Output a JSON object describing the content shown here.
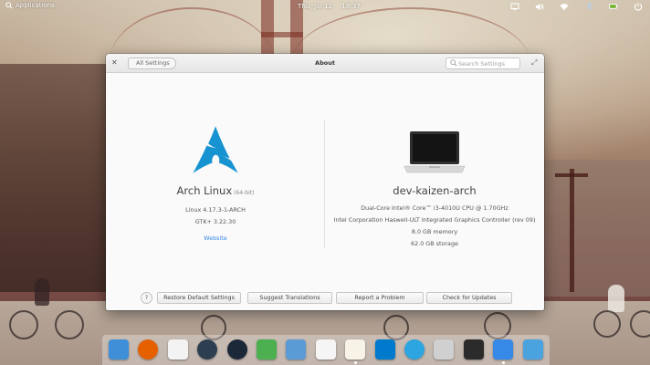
{
  "panel": {
    "applications_label": "Applications",
    "date": "Thu, Jul 12",
    "time": "18:37",
    "indicators": [
      "display-icon",
      "volume-icon",
      "wifi-icon",
      "bluetooth-icon",
      "battery-icon",
      "power-icon"
    ]
  },
  "window": {
    "title": "About",
    "back_label": "All Settings",
    "search_placeholder": "Search Settings",
    "close_icon": "close-icon",
    "maximize_icon": "maximize-icon"
  },
  "os": {
    "name": "Arch Linux",
    "arch": "(64-bit)",
    "kernel": "Linux 4.17.3-1-ARCH",
    "gtk": "GTK+ 3.22.30",
    "website_label": "Website",
    "logo_color": "#1793d1"
  },
  "hardware": {
    "hostname": "dev-kaizen-arch",
    "cpu": "Dual-Core Intel® Core™ i3-4010U CPU @ 1.70GHz",
    "graphics": "Intel Corporation Haswell-ULT Integrated Graphics Controller (rev 09)",
    "memory": "8.0 GB memory",
    "storage": "62.0 GB storage"
  },
  "footer": {
    "help_label": "?",
    "restore_label": "Restore Default Settings",
    "translations_label": "Suggest Translations",
    "report_label": "Report a Problem",
    "updates_label": "Check for Updates"
  },
  "dock": {
    "apps": [
      {
        "name": "multitasking-view-icon",
        "color": "#3f8fd8"
      },
      {
        "name": "firefox-icon",
        "color": "#e66000"
      },
      {
        "name": "calendar-icon",
        "color": "#f3f3f3"
      },
      {
        "name": "music-icon",
        "color": "#2c3e50"
      },
      {
        "name": "steam-icon",
        "color": "#1b2838"
      },
      {
        "name": "game-icon",
        "color": "#4caf50"
      },
      {
        "name": "photos-icon",
        "color": "#5b9bd5"
      },
      {
        "name": "text-editor-icon",
        "color": "#f5f5f5"
      },
      {
        "name": "code-icon",
        "color": "#f7f3e6"
      },
      {
        "name": "vscode-icon",
        "color": "#007acc"
      },
      {
        "name": "telegram-icon",
        "color": "#2ca5e0"
      },
      {
        "name": "files-icon",
        "color": "#d0d0d0"
      },
      {
        "name": "terminal-icon",
        "color": "#2b2b2b"
      },
      {
        "name": "switchboard-icon",
        "color": "#3689e6"
      },
      {
        "name": "desktop-icon",
        "color": "#4aa3df"
      }
    ]
  }
}
